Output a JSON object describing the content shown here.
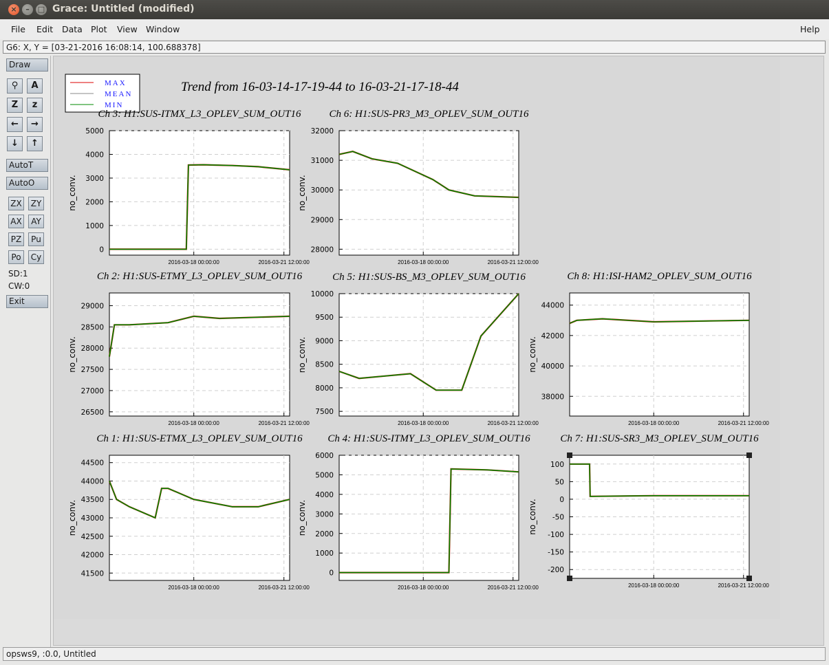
{
  "window": {
    "title": "Grace: Untitled (modified)",
    "close_glyph": "×",
    "min_glyph": "–",
    "max_glyph": "□"
  },
  "menu": {
    "file": "File",
    "edit": "Edit",
    "data": "Data",
    "plot": "Plot",
    "view": "View",
    "window": "Window",
    "help": "Help"
  },
  "locator": "G6: X, Y = [03-21-2016 16:08:14, 100.688378]",
  "toolbar": {
    "draw": "Draw",
    "autot": "AutoT",
    "autoo": "AutoO",
    "exit": "Exit",
    "icons": {
      "zoom": "⚲",
      "text": "A",
      "zoomx": "Z",
      "zoomy": "z",
      "left": "←",
      "right": "→",
      "down": "↓",
      "up": "↑"
    },
    "small": {
      "zx": "ZX",
      "zy": "ZY",
      "ax": "AX",
      "ay": "AY",
      "pz": "PZ",
      "pu": "Pu",
      "po": "Po",
      "cy": "Cy"
    },
    "sd": "SD:1",
    "cw": "CW:0"
  },
  "status": "opsws9, :0.0, Untitled",
  "colors": {
    "max": "#dd0000",
    "mean": "#888888",
    "min": "#008800",
    "legend_text": "#1a1aff"
  },
  "chart_data": {
    "type": "line",
    "title": "Trend from 16-03-14-17-19-44 to 16-03-21-17-18-44",
    "legend": {
      "placement": "top-left",
      "entries": [
        "MAX",
        "MEAN",
        "MIN"
      ]
    },
    "xticklabels": [
      "2016-03-18 00:00:00",
      "2016-03-21 12:00:00"
    ],
    "panels": [
      {
        "title": "Ch 3: H1:SUS-ITMX_L3_OPLEV_SUM_OUT16",
        "ylabel": "no_conv.",
        "yticks": [
          0,
          1000,
          2000,
          3000,
          4000,
          5000
        ],
        "ylim": [
          -250,
          5000
        ],
        "series": [
          {
            "name": "MEAN",
            "x": [
              "2016-03-14 17:19",
              "2016-03-17 17:00",
              "2016-03-17 19:00",
              "2016-03-18 09:00",
              "2016-03-19 12:00",
              "2016-03-20 12:00",
              "2016-03-21 17:18"
            ],
            "values": [
              0,
              0,
              3550,
              3560,
              3530,
              3480,
              3350
            ]
          }
        ]
      },
      {
        "title": "Ch 6: H1:SUS-PR3_M3_OPLEV_SUM_OUT16",
        "ylabel": "no_conv.",
        "yticks": [
          28000,
          29000,
          30000,
          31000,
          32000
        ],
        "ylim": [
          27800,
          32000
        ],
        "series": [
          {
            "name": "MEAN",
            "x": [
              "2016-03-14 17:19",
              "2016-03-15 06:00",
              "2016-03-16 00:00",
              "2016-03-17 00:00",
              "2016-03-18 09:00",
              "2016-03-19 00:00",
              "2016-03-20 00:00",
              "2016-03-21 17:18"
            ],
            "values": [
              31200,
              31300,
              31050,
              30900,
              30350,
              30000,
              29800,
              29750
            ]
          }
        ]
      },
      {
        "title": "Ch 2: H1:SUS-ETMY_L3_OPLEV_SUM_OUT16",
        "ylabel": "no_conv.",
        "yticks": [
          26500,
          27000,
          27500,
          28000,
          28500,
          29000
        ],
        "ylim": [
          26400,
          29300
        ],
        "series": [
          {
            "name": "MEAN",
            "x": [
              "2016-03-14 17:19",
              "2016-03-14 22:00",
              "2016-03-15 12:00",
              "2016-03-17 00:00",
              "2016-03-18 00:00",
              "2016-03-19 00:00",
              "2016-03-21 17:18"
            ],
            "values": [
              27800,
              28550,
              28550,
              28600,
              28750,
              28700,
              28750
            ]
          }
        ]
      },
      {
        "title": "Ch 5: H1:SUS-BS_M3_OPLEV_SUM_OUT16",
        "ylabel": "no_conv.",
        "yticks": [
          7500,
          8000,
          8500,
          9000,
          9500,
          10000
        ],
        "ylim": [
          7400,
          10000
        ],
        "series": [
          {
            "name": "MEAN",
            "x": [
              "2016-03-14 17:19",
              "2016-03-15 12:00",
              "2016-03-16 12:00",
              "2016-03-17 12:00",
              "2016-03-18 12:00",
              "2016-03-19 12:00",
              "2016-03-20 06:00",
              "2016-03-21 17:18"
            ],
            "values": [
              8350,
              8200,
              8250,
              8300,
              7950,
              7950,
              9100,
              10000
            ]
          }
        ]
      },
      {
        "title": "Ch 8: H1:ISI-HAM2_OPLEV_SUM_OUT16",
        "ylabel": "no_conv.",
        "yticks": [
          38000,
          40000,
          42000,
          44000
        ],
        "ylim": [
          36700,
          44800
        ],
        "series": [
          {
            "name": "MEAN",
            "x": [
              "2016-03-14 17:19",
              "2016-03-15 00:00",
              "2016-03-16 00:00",
              "2016-03-18 00:00",
              "2016-03-21 17:18"
            ],
            "values": [
              42800,
              43000,
              43100,
              42900,
              43000
            ]
          }
        ]
      },
      {
        "title": "Ch 1: H1:SUS-ETMX_L3_OPLEV_SUM_OUT16",
        "ylabel": "no_conv.",
        "yticks": [
          41500,
          42000,
          42500,
          43000,
          43500,
          44000,
          44500
        ],
        "ylim": [
          41300,
          44700
        ],
        "series": [
          {
            "name": "MEAN",
            "x": [
              "2016-03-14 17:19",
              "2016-03-15 00:00",
              "2016-03-15 12:00",
              "2016-03-16 12:00",
              "2016-03-16 18:00",
              "2016-03-17 00:00",
              "2016-03-18 00:00",
              "2016-03-19 12:00",
              "2016-03-20 12:00",
              "2016-03-21 17:18"
            ],
            "values": [
              44000,
              43500,
              43300,
              43000,
              43800,
              43800,
              43500,
              43300,
              43300,
              43500
            ]
          }
        ]
      },
      {
        "title": "Ch 4: H1:SUS-ITMY_L3_OPLEV_SUM_OUT16",
        "ylabel": "no_conv.",
        "yticks": [
          0,
          1000,
          2000,
          3000,
          4000,
          5000,
          6000
        ],
        "ylim": [
          -400,
          6000
        ],
        "series": [
          {
            "name": "MEAN",
            "x": [
              "2016-03-14 17:19",
              "2016-03-19 00:00",
              "2016-03-19 02:00",
              "2016-03-20 12:00",
              "2016-03-21 17:18"
            ],
            "values": [
              0,
              0,
              5300,
              5250,
              5150
            ]
          }
        ]
      },
      {
        "title": "Ch 7: H1:SUS-SR3_M3_OPLEV_SUM_OUT16",
        "ylabel": "no_conv.",
        "yticks": [
          -200,
          -150,
          -100,
          -50,
          0,
          50,
          100
        ],
        "ylim": [
          -225,
          125
        ],
        "series": [
          {
            "name": "MEAN",
            "x": [
              "2016-03-14 17:19",
              "2016-03-15 12:00",
              "2016-03-15 12:30",
              "2016-03-18 00:00",
              "2016-03-21 17:18"
            ],
            "values": [
              100,
              100,
              8,
              10,
              10
            ]
          }
        ]
      }
    ]
  }
}
